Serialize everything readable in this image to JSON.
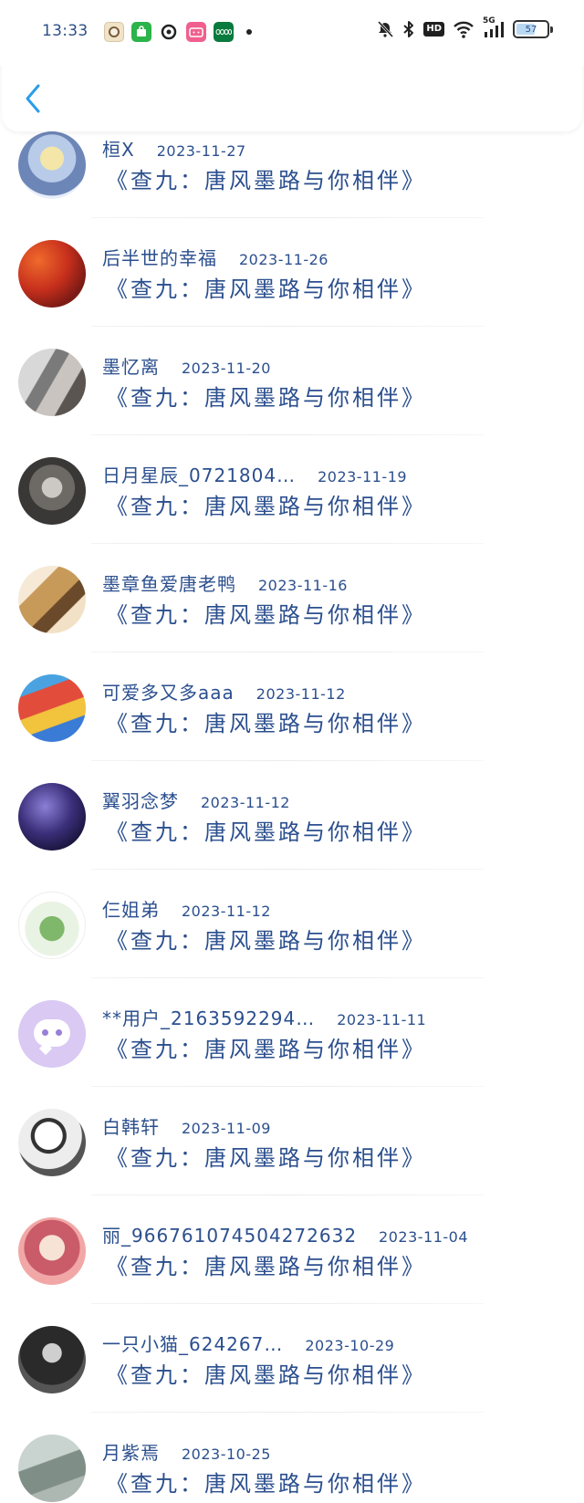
{
  "status_bar": {
    "time": "13:33",
    "battery_level": "57",
    "network": "5G",
    "hd_label": "HD",
    "app_icons": [
      "game-character-icon",
      "app-store-icon",
      "music-app-icon",
      "bilibili-icon",
      "oppo-icon"
    ]
  },
  "header": {
    "back_icon": "chevron-left-icon",
    "accent_color": "#2a9de8"
  },
  "comments": [
    {
      "name": "桓X",
      "date": "2023-11-27",
      "title": "《查九：唐风墨路与你相伴》"
    },
    {
      "name": "后半世的幸福",
      "date": "2023-11-26",
      "title": "《查九：唐风墨路与你相伴》"
    },
    {
      "name": "墨忆离",
      "date": "2023-11-20",
      "title": "《查九：唐风墨路与你相伴》"
    },
    {
      "name": "日月星辰_0721804…",
      "date": "2023-11-19",
      "title": "《查九：唐风墨路与你相伴》"
    },
    {
      "name": "墨章鱼爱唐老鸭",
      "date": "2023-11-16",
      "title": "《查九：唐风墨路与你相伴》"
    },
    {
      "name": "可爱多又多aaa",
      "date": "2023-11-12",
      "title": "《查九：唐风墨路与你相伴》"
    },
    {
      "name": "翼羽念梦",
      "date": "2023-11-12",
      "title": "《查九：唐风墨路与你相伴》"
    },
    {
      "name": "仨姐弟",
      "date": "2023-11-12",
      "title": "《查九：唐风墨路与你相伴》"
    },
    {
      "name": "**用户_2163592294…",
      "date": "2023-11-11",
      "title": "《查九：唐风墨路与你相伴》"
    },
    {
      "name": "白韩轩",
      "date": "2023-11-09",
      "title": "《查九：唐风墨路与你相伴》"
    },
    {
      "name": "丽_966761074504272632",
      "date": "2023-11-04",
      "title": "《查九：唐风墨路与你相伴》"
    },
    {
      "name": "一只小猫_624267…",
      "date": "2023-10-29",
      "title": "《查九：唐风墨路与你相伴》"
    },
    {
      "name": "月紫焉",
      "date": "2023-10-25",
      "title": "《查九：唐风墨路与你相伴》"
    }
  ],
  "colors": {
    "text": "#2b4f8e",
    "divider": "#ececec"
  }
}
